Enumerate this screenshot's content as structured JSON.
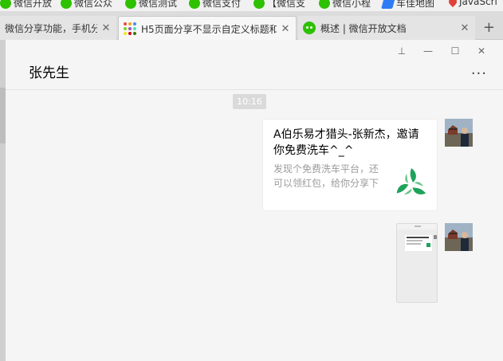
{
  "bookmarks": [
    {
      "label": "微信开放",
      "icon": "wechat-icon"
    },
    {
      "label": "微信公众",
      "icon": "wechat-icon"
    },
    {
      "label": "微信测试",
      "icon": "wechat-icon"
    },
    {
      "label": "微信支付",
      "icon": "wechat-icon"
    },
    {
      "label": "【微信支",
      "icon": "wechat-icon"
    },
    {
      "label": "微信小程",
      "icon": "wechat-icon"
    },
    {
      "label": "车佳地图",
      "icon": "map-icon"
    },
    {
      "label": "JavaScri",
      "icon": "pin-icon"
    }
  ],
  "tabs": [
    {
      "title": "微信分享功能，手机分",
      "close": "✕",
      "active": false
    },
    {
      "title": "H5页面分享不显示自定义标题和",
      "close": "✕",
      "active": true
    },
    {
      "title": "概述 | 微信开放文档",
      "close": "✕",
      "active": false
    }
  ],
  "new_tab_label": "+",
  "window": {
    "pin": "⊥",
    "minimize": "—",
    "maximize": "☐",
    "close": "✕"
  },
  "chat": {
    "title": "张先生",
    "more": "···",
    "timestamp": "10:16",
    "card": {
      "title": "A伯乐易才猎头-张新杰，邀请你免费洗车^_^",
      "description": "发现个免费洗车平台，还可以领红包，给你分享下"
    }
  },
  "colors": {
    "wechat_green": "#2dc100",
    "logo_green": "#1fa35a",
    "chat_bg": "#f5f5f5"
  }
}
